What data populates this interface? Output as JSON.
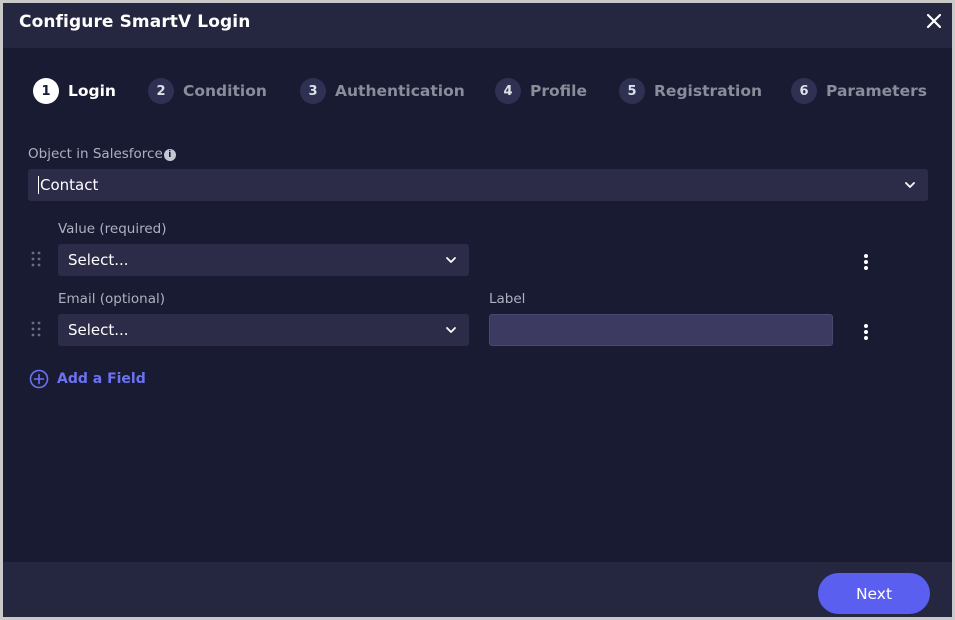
{
  "window": {
    "title": "Configure SmartV Login"
  },
  "steps": [
    {
      "number": "1",
      "label": "Login",
      "active": true
    },
    {
      "number": "2",
      "label": "Condition",
      "active": false
    },
    {
      "number": "3",
      "label": "Authentication",
      "active": false
    },
    {
      "number": "4",
      "label": "Profile",
      "active": false
    },
    {
      "number": "5",
      "label": "Registration",
      "active": false
    },
    {
      "number": "6",
      "label": "Parameters",
      "active": false
    }
  ],
  "object": {
    "label": "Object in Salesforce",
    "value": "Contact"
  },
  "fields": [
    {
      "label": "Value (required)",
      "value": "Select..."
    },
    {
      "label": "Email (optional)",
      "value": "Select...",
      "extra_label": "Label",
      "extra_value": ""
    }
  ],
  "add_field_label": "Add a Field",
  "footer": {
    "next_label": "Next"
  },
  "colors": {
    "background": "#191b33",
    "header": "#25263f",
    "accent": "#5b5ff0",
    "link": "#6c72f0"
  },
  "icons": {
    "close": "close-icon",
    "info": "info-icon",
    "chevron": "chevron-down-icon",
    "drag": "drag-handle-icon",
    "more": "kebab-menu-icon",
    "add": "plus-circle-icon"
  }
}
